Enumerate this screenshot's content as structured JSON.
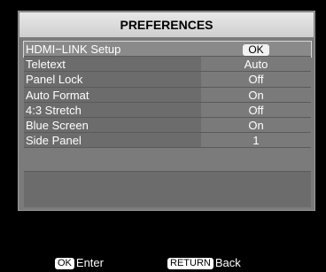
{
  "menu": {
    "title": "PREFERENCES",
    "items": [
      {
        "label": "HDMI−LINK Setup",
        "value": "OK"
      },
      {
        "label": "Teletext",
        "value": "Auto"
      },
      {
        "label": "Panel Lock",
        "value": "Off"
      },
      {
        "label": "Auto Format",
        "value": "On"
      },
      {
        "label": "4:3 Stretch",
        "value": "Off"
      },
      {
        "label": "Blue Screen",
        "value": "On"
      },
      {
        "label": "Side Panel",
        "value": "1"
      }
    ]
  },
  "footer": {
    "ok_key": "OK",
    "ok_action": "Enter",
    "return_key": "RETURN",
    "return_action": "Back"
  }
}
